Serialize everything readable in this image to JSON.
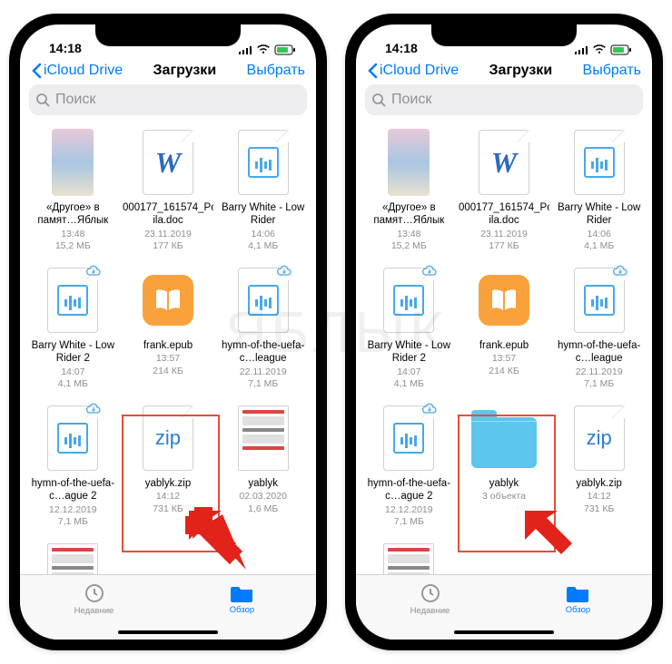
{
  "watermark": "ЯБЛЫК",
  "status": {
    "time": "14:18"
  },
  "nav": {
    "back": "iCloud Drive",
    "title": "Загрузки",
    "select": "Выбрать"
  },
  "search": {
    "placeholder": "Поиск"
  },
  "tabs": {
    "recents": "Недавние",
    "browse": "Обзор"
  },
  "left_files": [
    {
      "name": "«Другое» в памят…Яблык",
      "meta1": "13:48",
      "meta2": "15,2 МБ",
      "kind": "image"
    },
    {
      "name": "000177_161574_Post-…ila.doc",
      "meta1": "23.11.2019",
      "meta2": "177 КБ",
      "kind": "word"
    },
    {
      "name": "Barry White - Low Rider",
      "meta1": "14:06",
      "meta2": "4,1 МБ",
      "kind": "audio"
    },
    {
      "name": "Barry White - Low Rider 2",
      "meta1": "14:07",
      "meta2": "4,1 МБ",
      "kind": "audio",
      "cloud": true
    },
    {
      "name": "frank.epub",
      "meta1": "13:57",
      "meta2": "214 КБ",
      "kind": "epub"
    },
    {
      "name": "hymn-of-the-uefa-c…league",
      "meta1": "22.11.2019",
      "meta2": "7,1 МБ",
      "kind": "audio",
      "cloud": true
    },
    {
      "name": "hymn-of-the-uefa-c…ague 2",
      "meta1": "12.12.2019",
      "meta2": "7,1 МБ",
      "kind": "audio",
      "cloud": true
    },
    {
      "name": "yablyk.zip",
      "meta1": "14:12",
      "meta2": "731 КБ",
      "kind": "zip"
    },
    {
      "name": "yablyk",
      "meta1": "02.03.2020",
      "meta2": "1,6 МБ",
      "kind": "page"
    },
    {
      "name": "",
      "meta1": "",
      "meta2": "",
      "kind": "page"
    }
  ],
  "right_files": [
    {
      "name": "«Другое» в памят…Яблык",
      "meta1": "13:48",
      "meta2": "15,2 МБ",
      "kind": "image"
    },
    {
      "name": "000177_161574_Post-…ila.doc",
      "meta1": "23.11.2019",
      "meta2": "177 КБ",
      "kind": "word"
    },
    {
      "name": "Barry White - Low Rider",
      "meta1": "14:06",
      "meta2": "4,1 МБ",
      "kind": "audio"
    },
    {
      "name": "Barry White - Low Rider 2",
      "meta1": "14:07",
      "meta2": "4,1 МБ",
      "kind": "audio",
      "cloud": true
    },
    {
      "name": "frank.epub",
      "meta1": "13:57",
      "meta2": "214 КБ",
      "kind": "epub"
    },
    {
      "name": "hymn-of-the-uefa-c…league",
      "meta1": "22.11.2019",
      "meta2": "7,1 МБ",
      "kind": "audio",
      "cloud": true
    },
    {
      "name": "hymn-of-the-uefa-c…ague 2",
      "meta1": "12.12.2019",
      "meta2": "7,1 МБ",
      "kind": "audio",
      "cloud": true
    },
    {
      "name": "yablyk",
      "meta1": "3 объекта",
      "meta2": "",
      "kind": "folder"
    },
    {
      "name": "yablyk.zip",
      "meta1": "14:12",
      "meta2": "731 КБ",
      "kind": "zip"
    },
    {
      "name": "",
      "meta1": "",
      "meta2": "",
      "kind": "page"
    }
  ]
}
